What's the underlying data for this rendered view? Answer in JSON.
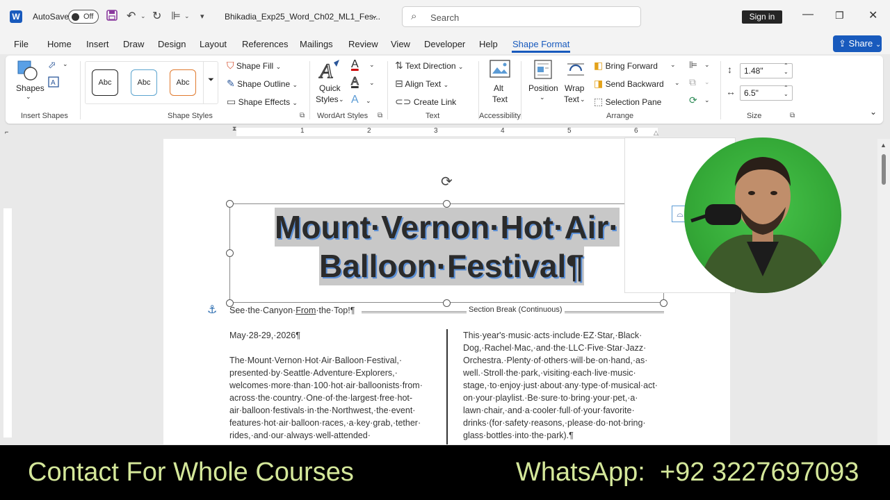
{
  "titlebar": {
    "autosave_label": "AutoSave",
    "autosave_state": "Off",
    "doc_title": "Bhikadia_Exp25_Word_Ch02_ML1_Fes...",
    "search_placeholder": "Search",
    "signin_label": "Sign in"
  },
  "menu": {
    "tabs": [
      "File",
      "Home",
      "Insert",
      "Draw",
      "Design",
      "Layout",
      "References",
      "Mailings",
      "Review",
      "View",
      "Developer",
      "Help",
      "Shape Format"
    ],
    "active_tab": "Shape Format",
    "share_label": "Share"
  },
  "ribbon": {
    "insert_shapes": {
      "shapes_label": "Shapes",
      "group_label": "Insert Shapes"
    },
    "shape_styles": {
      "styles": [
        "Abc",
        "Abc",
        "Abc"
      ],
      "shape_fill": "Shape Fill",
      "shape_outline": "Shape Outline",
      "shape_effects": "Shape Effects",
      "group_label": "Shape Styles"
    },
    "wordart": {
      "quick_styles_1": "Quick",
      "quick_styles_2": "Styles",
      "group_label": "WordArt Styles"
    },
    "text": {
      "text_direction": "Text Direction",
      "align_text": "Align Text",
      "create_link": "Create Link",
      "group_label": "Text"
    },
    "accessibility": {
      "alt_1": "Alt",
      "alt_2": "Text",
      "group_label": "Accessibility"
    },
    "arrange": {
      "position": "Position",
      "wrap_1": "Wrap",
      "wrap_2": "Text",
      "bring_forward": "Bring Forward",
      "send_backward": "Send Backward",
      "selection_pane": "Selection Pane",
      "group_label": "Arrange"
    },
    "size": {
      "height": "1.48\"",
      "width": "6.5\"",
      "group_label": "Size"
    }
  },
  "ruler": {
    "numbers": [
      "1",
      "2",
      "3",
      "4",
      "5",
      "6"
    ]
  },
  "document": {
    "title_line1": "Mount·Vernon·Hot·Air·",
    "title_line2": "Balloon·Festival¶",
    "subtitle_pre": "See·the·Canyon·",
    "subtitle_link": "From",
    "subtitle_post": "·the·Top!¶",
    "section_break": "Section Break (Continuous)",
    "date": "May·28-29,·2026¶",
    "col1": [
      "The·Mount·Vernon·Hot·Air·Balloon·Festival,·",
      "presented·by·Seattle·Adventure·Explorers,·",
      "welcomes·more·than·100·hot·air·balloonists·from·",
      "across·the·country.·One·of·the·largest·free·hot-",
      "air·balloon·festivals·in·the·Northwest,·the·event·",
      "features·hot·air·balloon·races,·a·key·grab,·tether·",
      "rides,·and·our·always·well-attended·"
    ],
    "col2": [
      "This·year's·music·acts·include·EZ·Star,·Black·",
      "Dog,·Rachel·Mac,·and·the·LLC·Five·Star·Jazz·",
      "Orchestra.·Plenty·of·others·will·be·on·hand,·as·",
      "well.·Stroll·the·park,·visiting·each·live·music·",
      "stage,·to·enjoy·just·about·any·type·of·musical·act·",
      "on·your·playlist.·Be·sure·to·bring·your·pet,·a·",
      "lawn·chair,·and·a·cooler·full·of·your·favorite·",
      "drinks·(for·safety·reasons,·please·do·not·bring·",
      "glass·bottles·into·the·park).¶"
    ]
  },
  "banner": {
    "left": "Contact For Whole Courses",
    "right": "WhatsApp:  +92 3227697093"
  },
  "colors": {
    "accent": "#185abd",
    "banner_text": "#d4e79a"
  }
}
